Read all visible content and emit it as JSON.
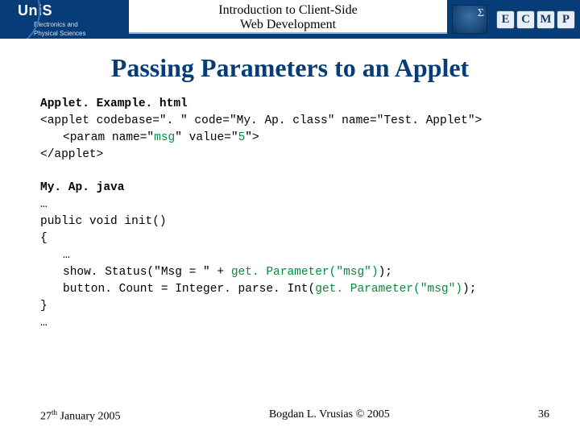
{
  "header": {
    "org": "UniS",
    "tagline1": "Electronics and",
    "tagline2": "Physical Sciences",
    "course_line1": "Introduction to Client-Side",
    "course_line2": "Web Development",
    "thumb_sym": "Σ",
    "badges": [
      "E",
      "C",
      "M",
      "P"
    ]
  },
  "title": "Passing Parameters to an Applet",
  "code1": {
    "file": "Applet. Example. html",
    "l1a": "<applet codebase=\". \" code=\"",
    "l1b": "My. Ap. class",
    "l1c": "\" name=\"",
    "l1d": "Test. Applet",
    "l1e": "\">",
    "l2a": "<param name=\"",
    "l2b": "msg",
    "l2c": "\" value=\"",
    "l2d": "5",
    "l2e": "\">",
    "l3": "</applet>"
  },
  "code2": {
    "file": "My. Ap. java",
    "l1": "…",
    "l2": "public void init()",
    "l3": "{",
    "l4": "…",
    "l5a": "show. Status(\"Msg = \" + ",
    "l5b": "get. Parameter(\"msg\")",
    "l5c": ");",
    "l6a": "button. Count = Integer. parse. Int(",
    "l6b": "get. Parameter(\"msg\")",
    "l6c": ");",
    "l7": "}",
    "l8": "…"
  },
  "footer": {
    "date_pre": "27",
    "date_sup": "th",
    "date_post": " January 2005",
    "author": "Bogdan L. Vrusias © 2005",
    "page": "36"
  }
}
